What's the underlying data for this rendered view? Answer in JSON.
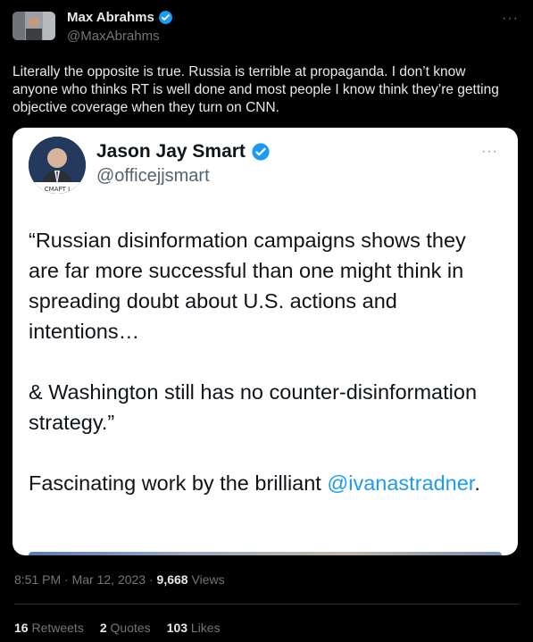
{
  "tweet": {
    "author": {
      "name": "Max Abrahms",
      "handle": "@MaxAbrahms"
    },
    "more_label": "···",
    "text": "Literally the opposite is true. Russia is terrible at propaganda. I don’t know anyone who thinks RT is well done and most people I know think they’re getting objective coverage when they turn on CNN.",
    "quoted": {
      "author": {
        "name": "Jason Jay Smart",
        "handle": "@officejjsmart"
      },
      "avatar_caption": "СМАРТ І",
      "more_label": "···",
      "text_main": "“Russian disinformation campaigns shows they are far more successful than one might think in spreading doubt about U.S. actions and intentions…\n\n& Washington still has no counter-disinformation strategy.”\n\nFascinating work by the brilliant ",
      "mention": "@ivanastradner",
      "text_end": "."
    },
    "meta": {
      "time": "8:51 PM",
      "sep1": " · ",
      "date": "Mar 12, 2023",
      "sep2": " · ",
      "views": "9,668",
      "views_label": " Views"
    },
    "stats": {
      "retweets": "16",
      "retweets_label": " Retweets",
      "quotes": "2",
      "quotes_label": " Quotes",
      "likes": "103",
      "likes_label": " Likes"
    }
  },
  "colors": {
    "background": "#000000",
    "verified": "#1d9bf0",
    "link": "#1d9bf0",
    "muted": "#71767b"
  }
}
